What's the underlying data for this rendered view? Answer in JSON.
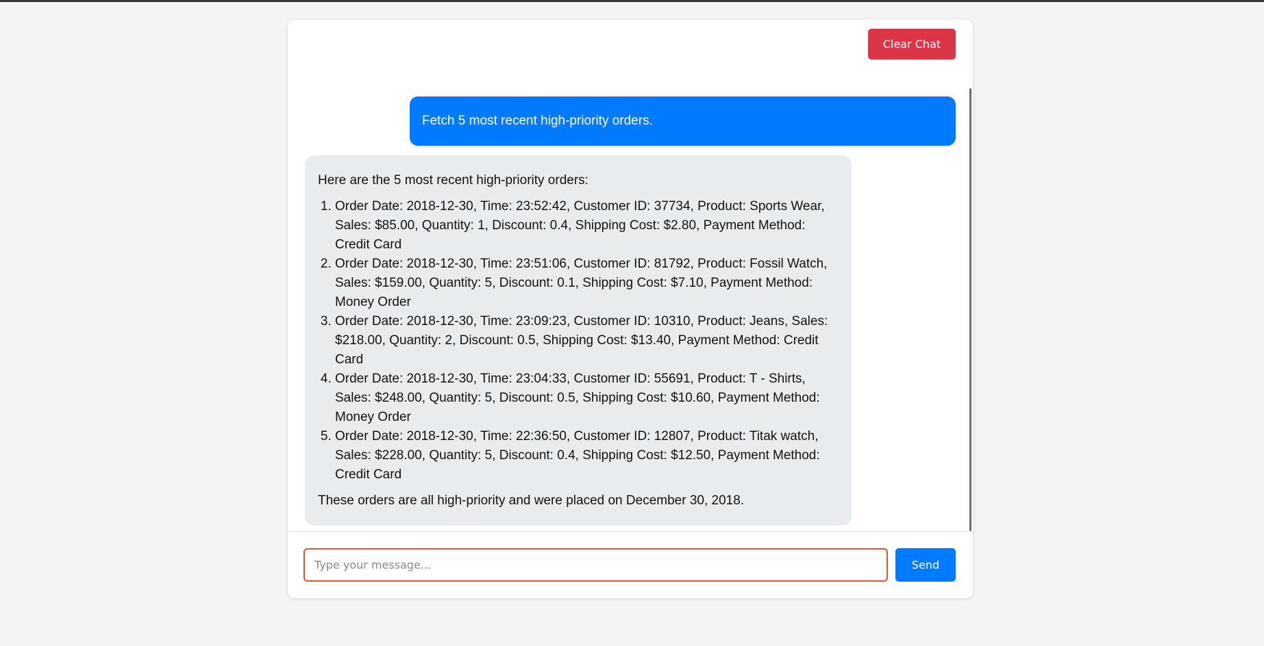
{
  "header": {
    "clear_label": "Clear Chat"
  },
  "conversation": {
    "user_message": "Fetch 5 most recent high-priority orders.",
    "bot_intro": "Here are the 5 most recent high-priority orders:",
    "orders": [
      "Order Date: 2018-12-30, Time: 23:52:42, Customer ID: 37734, Product: Sports Wear, Sales: $85.00, Quantity: 1, Discount: 0.4, Shipping Cost: $2.80, Payment Method: Credit Card",
      "Order Date: 2018-12-30, Time: 23:51:06, Customer ID: 81792, Product: Fossil Watch, Sales: $159.00, Quantity: 5, Discount: 0.1, Shipping Cost: $7.10, Payment Method: Money Order",
      "Order Date: 2018-12-30, Time: 23:09:23, Customer ID: 10310, Product: Jeans, Sales: $218.00, Quantity: 2, Discount: 0.5, Shipping Cost: $13.40, Payment Method: Credit Card",
      "Order Date: 2018-12-30, Time: 23:04:33, Customer ID: 55691, Product: T - Shirts, Sales: $248.00, Quantity: 5, Discount: 0.5, Shipping Cost: $10.60, Payment Method: Money Order",
      "Order Date: 2018-12-30, Time: 22:36:50, Customer ID: 12807, Product: Titak watch, Sales: $228.00, Quantity: 5, Discount: 0.4, Shipping Cost: $12.50, Payment Method: Credit Card"
    ],
    "bot_outro": "These orders are all high-priority and were placed on December 30, 2018."
  },
  "composer": {
    "placeholder": "Type your message...",
    "value": "",
    "send_label": "Send"
  },
  "colors": {
    "clear_button": "#dc3545",
    "primary": "#007bff",
    "bot_bubble": "#e8ecef",
    "input_focus_border": "#e8542a"
  }
}
